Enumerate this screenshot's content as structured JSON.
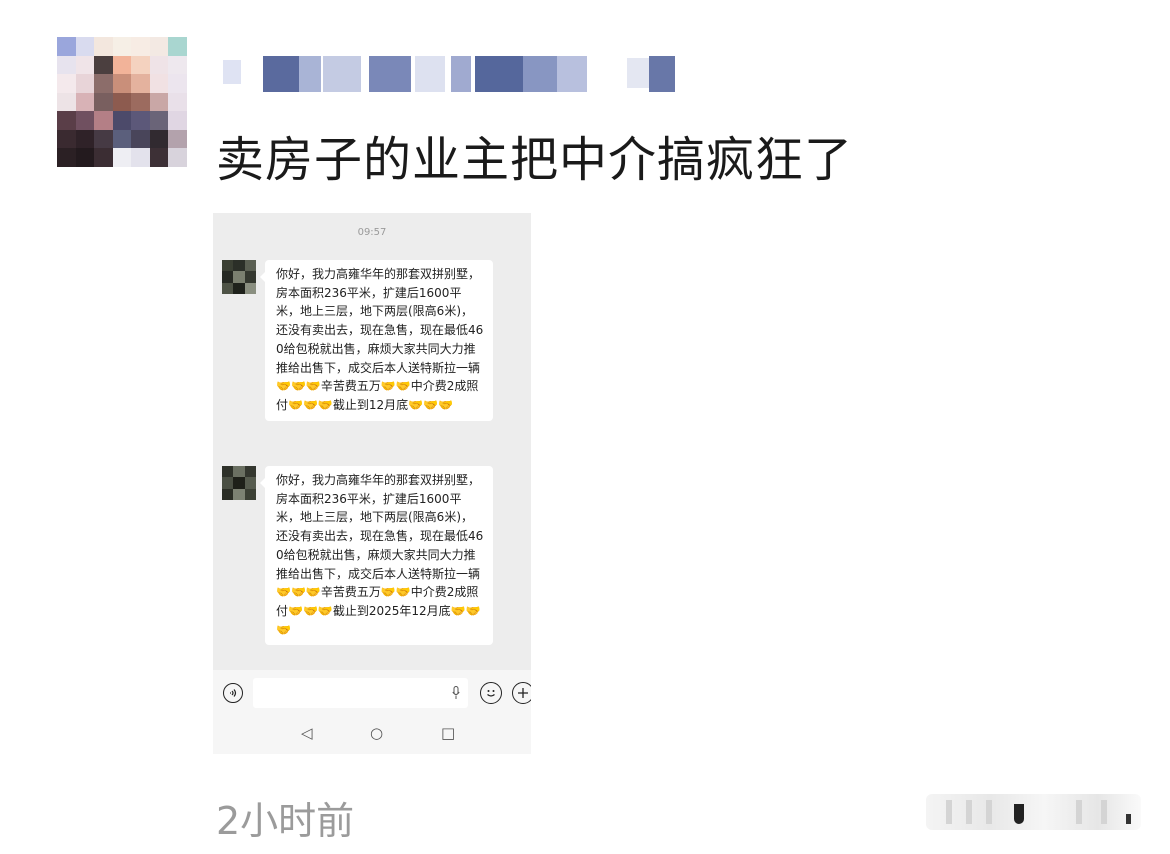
{
  "post": {
    "text": "卖房子的业主把中介搞疯狂了",
    "time": "2小时前"
  },
  "screenshot": {
    "time": "09:57",
    "messages": [
      {
        "text": "你好，我力高雍华年的那套双拼别墅，房本面积236平米，扩建后1600平米，地上三层，地下两层(限高6米)，还没有卖出去，现在急售，现在最低460给包税就出售，麻烦大家共同大力推推给出售下，成交后本人送特斯拉一辆🤝🤝🤝辛苦费五万🤝🤝中介费2成照付🤝🤝🤝截止到12月底🤝🤝🤝"
      },
      {
        "text": "你好，我力高雍华年的那套双拼别墅，房本面积236平米，扩建后1600平米，地上三层，地下两层(限高6米)，还没有卖出去，现在急售，现在最低460给包税就出售，麻烦大家共同大力推推给出售下，成交后本人送特斯拉一辆🤝🤝🤝辛苦费五万🤝🤝中介费2成照付🤝🤝🤝截止到2025年12月底🤝🤝🤝"
      }
    ],
    "nav": {
      "back": "◁",
      "home": "○",
      "recent": "□"
    },
    "icons": {
      "voice": "voice-icon",
      "emoji": "emoji-icon",
      "plus": "plus-icon",
      "mic": "mic-icon"
    }
  },
  "colors": {
    "post_text": "#1a1a1a",
    "time_text": "#9b9b9b",
    "chat_background": "#ededed",
    "bubble": "#ffffff"
  }
}
